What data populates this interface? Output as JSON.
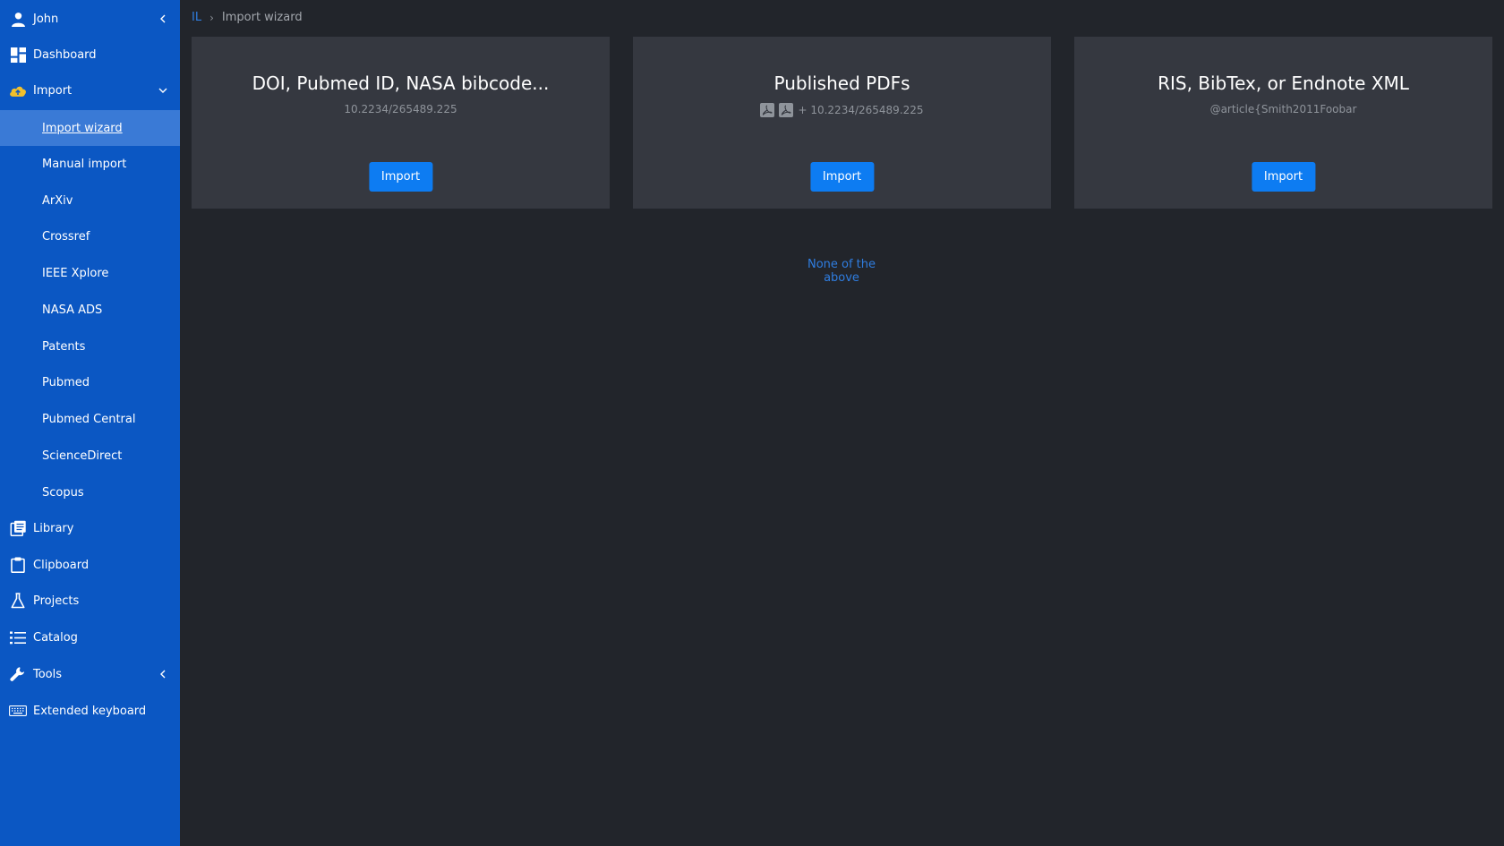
{
  "sidebar": {
    "user": {
      "label": "John",
      "icon": "user-icon"
    },
    "items": [
      {
        "label": "Dashboard",
        "icon": "dashboard-icon"
      },
      {
        "label": "Import",
        "icon": "cloud-upload-icon"
      },
      {
        "label": "Import wizard"
      },
      {
        "label": "Manual import"
      },
      {
        "label": "ArXiv"
      },
      {
        "label": "Crossref"
      },
      {
        "label": "IEEE Xplore"
      },
      {
        "label": "NASA ADS"
      },
      {
        "label": "Patents"
      },
      {
        "label": "Pubmed"
      },
      {
        "label": "Pubmed Central"
      },
      {
        "label": "ScienceDirect"
      },
      {
        "label": "Scopus"
      },
      {
        "label": "Library",
        "icon": "library-icon"
      },
      {
        "label": "Clipboard",
        "icon": "clipboard-icon"
      },
      {
        "label": "Projects",
        "icon": "flask-icon"
      },
      {
        "label": "Catalog",
        "icon": "list-icon"
      },
      {
        "label": "Tools",
        "icon": "wrench-icon"
      },
      {
        "label": "Extended keyboard",
        "icon": "keyboard-icon"
      }
    ]
  },
  "breadcrumb": {
    "root": "IL",
    "separator": "›",
    "current": "Import wizard"
  },
  "cards": [
    {
      "title": "DOI, Pubmed ID, NASA bibcode...",
      "subtitle": "10.2234/265489.225",
      "button": "Import"
    },
    {
      "title": "Published PDFs",
      "subtitle": "+ 10.2234/265489.225",
      "button": "Import"
    },
    {
      "title": "RIS, BibTex, or Endnote XML",
      "subtitle": "@article{Smith2011Foobar",
      "button": "Import"
    }
  ],
  "none_link": "None of the above",
  "colors": {
    "sidebar": "#0b57c3",
    "active": "#3a7ad6",
    "background": "#22252b",
    "card": "#353840",
    "button": "#0d7cf2",
    "link": "#2f7de0"
  }
}
